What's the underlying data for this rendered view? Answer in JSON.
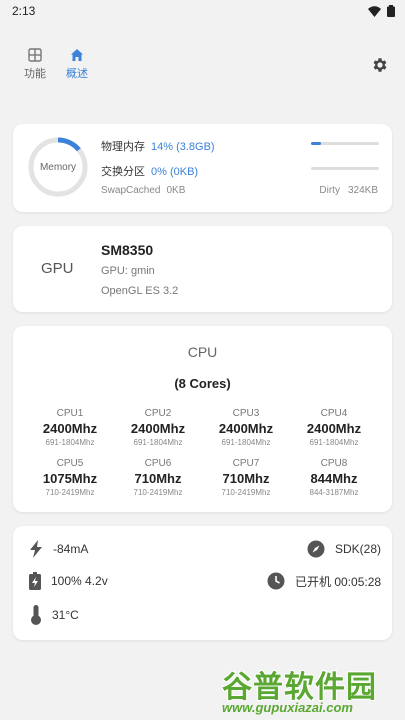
{
  "status_bar": {
    "time": "2:13"
  },
  "nav": {
    "tabs": [
      {
        "label": "功能",
        "icon": "grid-icon"
      },
      {
        "label": "概述",
        "icon": "home-icon"
      }
    ],
    "active_tab": "概述"
  },
  "memory": {
    "ring_label": "Memory",
    "ring_percent": 14,
    "physical": {
      "label": "物理内存",
      "value": "14% (3.8GB)",
      "percent": 14
    },
    "swap": {
      "label": "交换分区",
      "value": "0% (0KB)",
      "percent": 0
    },
    "swap_cached": {
      "label": "SwapCached",
      "value": "0KB"
    },
    "dirty": {
      "label": "Dirty",
      "value": "324KB"
    }
  },
  "gpu": {
    "label": "GPU",
    "model": "SM8350",
    "vendor": "GPU: gmin",
    "api": "OpenGL ES 3.2"
  },
  "cpu": {
    "title": "CPU",
    "cores_label": "(8 Cores)",
    "cores": [
      {
        "name": "CPU1",
        "freq": "2400Mhz",
        "range": "691-1804Mhz"
      },
      {
        "name": "CPU2",
        "freq": "2400Mhz",
        "range": "691-1804Mhz"
      },
      {
        "name": "CPU3",
        "freq": "2400Mhz",
        "range": "691-1804Mhz"
      },
      {
        "name": "CPU4",
        "freq": "2400Mhz",
        "range": "691-1804Mhz"
      },
      {
        "name": "CPU5",
        "freq": "1075Mhz",
        "range": "710-2419Mhz"
      },
      {
        "name": "CPU6",
        "freq": "710Mhz",
        "range": "710-2419Mhz"
      },
      {
        "name": "CPU7",
        "freq": "710Mhz",
        "range": "710-2419Mhz"
      },
      {
        "name": "CPU8",
        "freq": "844Mhz",
        "range": "844-3187Mhz"
      }
    ]
  },
  "device_status": {
    "current": "-84mA",
    "battery": "100% 4.2v",
    "temperature": "31°C",
    "sdk": "SDK(28)",
    "uptime": "已开机 00:05:28"
  },
  "watermark": {
    "brand": "谷普软件园",
    "url": "www.gupuxiazai.com"
  },
  "colors": {
    "accent": "#3b82d8",
    "background": "#f2f2f2",
    "card": "#ffffff"
  }
}
